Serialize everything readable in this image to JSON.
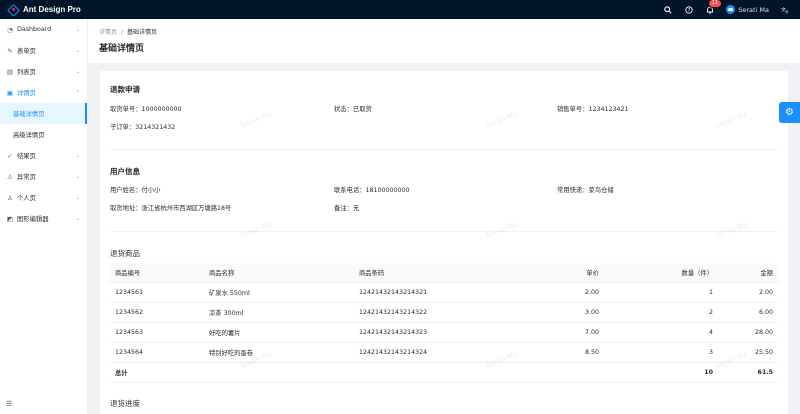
{
  "header": {
    "app_title": "Ant Design Pro",
    "notification_count": "11",
    "user_name": "Serati Ma",
    "icons": [
      "search-icon",
      "question-icon",
      "bell-icon",
      "translate-icon"
    ]
  },
  "sidebar": {
    "items": [
      {
        "label": "Dashboard",
        "icon": "dashboard-icon"
      },
      {
        "label": "表单页",
        "icon": "form-icon"
      },
      {
        "label": "列表页",
        "icon": "table-icon"
      },
      {
        "label": "详情页",
        "icon": "profile-icon"
      },
      {
        "label": "基础详情页"
      },
      {
        "label": "高级详情页"
      },
      {
        "label": "结果页",
        "icon": "check-circle-icon"
      },
      {
        "label": "异常页",
        "icon": "warning-icon"
      },
      {
        "label": "个人页",
        "icon": "user-icon"
      },
      {
        "label": "图形编辑器",
        "icon": "highlight-icon"
      }
    ]
  },
  "breadcrumb": {
    "parent": "详情页",
    "separator": "/",
    "current": "基础详情页"
  },
  "page_title": "基础详情页",
  "refund": {
    "title": "退款申请",
    "order_no": "取货单号：1000000000",
    "status": "状态：已取货",
    "sales_no": "销售单号：1234123421",
    "sub_order": "子订单：3214321432"
  },
  "user_info": {
    "title": "用户信息",
    "name": "用户姓名：付小小",
    "phone": "联系电话：18100000000",
    "express": "常用快递：菜鸟仓储",
    "address": "取货地址：浙江省杭州市西湖区万塘路18号",
    "remark": "备注：无"
  },
  "goods": {
    "title": "退货商品",
    "columns": [
      "商品编号",
      "商品名称",
      "商品条码",
      "单价",
      "数量（件）",
      "金额"
    ],
    "rows": [
      [
        "1234561",
        "矿泉水 550ml",
        "12421432143214321",
        "2.00",
        "1",
        "2.00"
      ],
      [
        "1234562",
        "凉茶 300ml",
        "12421432143214322",
        "3.00",
        "2",
        "6.00"
      ],
      [
        "1234563",
        "好吃的薯片",
        "12421432143214323",
        "7.00",
        "4",
        "28.00"
      ],
      [
        "1234564",
        "特别好吃的蛋卷",
        "12421432143214324",
        "8.50",
        "3",
        "25.50"
      ]
    ],
    "total": [
      "总计",
      "",
      "",
      "",
      "10",
      "61.5"
    ]
  },
  "progress": {
    "title": "退货进度"
  },
  "watermark": "Serati Ma",
  "colors": {
    "primary": "#1890ff",
    "header_bg": "#001529",
    "badge": "#ff4d4f"
  }
}
